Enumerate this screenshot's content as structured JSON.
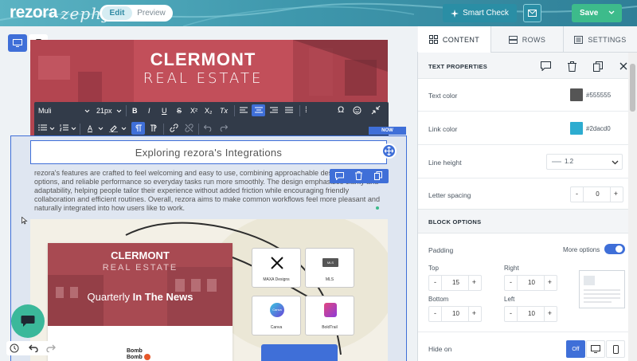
{
  "app": {
    "logo": "rezora",
    "logo_sub": "zephyr"
  },
  "topbar": {
    "mode_edit": "Edit",
    "mode_preview": "Preview",
    "smart_check": "Smart Check",
    "save": "Save"
  },
  "canvas": {
    "hero_title": "CLERMONT",
    "hero_subtitle": "REAL ESTATE",
    "toolbar": {
      "font": "Muli",
      "size": "21px",
      "bold": "B",
      "italic": "I",
      "underline": "U",
      "strike": "S",
      "sup": "X²",
      "sub": "X₂",
      "clear": "Tx",
      "omega": "Ω",
      "color_a": "A"
    },
    "now_badge": "NOW",
    "heading": "Exploring rezora's Integrations",
    "paragraph": "rezora's features are crafted to feel welcoming and easy to use, combining approachable design with flexible options, and reliable performance so everyday tasks run more smoothly. The design emphasizes clarity and adaptability, helping people tailor their experience without added friction while encouraging friendly collaboration and efficient routines. Overall, rezora aims to make common workflows feel more pleasant and naturally integrated into how users like to work.",
    "card": {
      "title": "CLERMONT",
      "subtitle": "REAL ESTATE",
      "news_prefix": "Quarterly ",
      "news_bold": "In The News",
      "bomb1": "Bomb",
      "bomb2": "Bomb"
    },
    "tiles": [
      {
        "label": "MAXA Designs"
      },
      {
        "label": "MLS"
      },
      {
        "label": "Canva"
      },
      {
        "label": "BoldTrail"
      }
    ],
    "tile_icon_mls": "MLS",
    "tile_icon_canva": "Canva"
  },
  "sidebar": {
    "tabs": [
      {
        "label": "CONTENT",
        "icon": "grid-icon"
      },
      {
        "label": "ROWS",
        "icon": "rows-icon"
      },
      {
        "label": "SETTINGS",
        "icon": "settings-icon"
      }
    ],
    "text_properties": {
      "title": "TEXT PROPERTIES",
      "text_color_label": "Text color",
      "text_color": "#555555",
      "link_color_label": "Link color",
      "link_color": "#2dacd0",
      "line_height_label": "Line height",
      "line_height": "1.2",
      "letter_spacing_label": "Letter spacing",
      "letter_spacing": "0"
    },
    "block_options": {
      "title": "BLOCK OPTIONS",
      "padding_label": "Padding",
      "more_options_label": "More options",
      "more_options_on": true,
      "top_label": "Top",
      "top": "15",
      "right_label": "Right",
      "right": "10",
      "bottom_label": "Bottom",
      "bottom": "10",
      "left_label": "Left",
      "left": "10",
      "hide_on_label": "Hide on",
      "hide_off": "Off"
    }
  },
  "colors": {
    "accent": "#3f6fd8",
    "topbar": "#3f98ad",
    "save": "#3dbb8b",
    "hero": "#c24f5a",
    "toolbar": "#323b49",
    "text_color_swatch": "#555555",
    "link_color_swatch": "#2dacd0"
  }
}
